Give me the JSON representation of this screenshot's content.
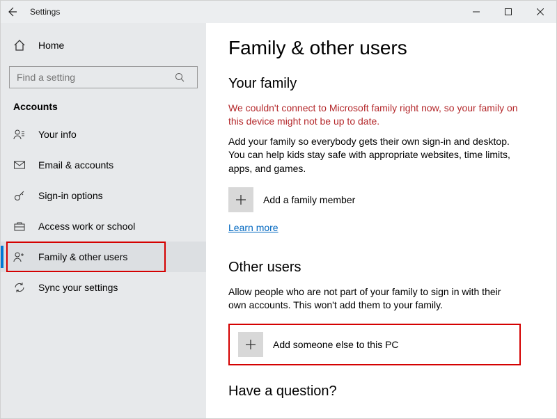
{
  "titlebar": {
    "title": "Settings"
  },
  "sidebar": {
    "home": "Home",
    "search_placeholder": "Find a setting",
    "section": "Accounts",
    "items": [
      {
        "label": "Your info"
      },
      {
        "label": "Email & accounts"
      },
      {
        "label": "Sign-in options"
      },
      {
        "label": "Access work or school"
      },
      {
        "label": "Family & other users"
      },
      {
        "label": "Sync your settings"
      }
    ]
  },
  "content": {
    "title": "Family & other users",
    "family_heading": "Your family",
    "family_error": "We couldn't connect to Microsoft family right now, so your family on this device might not be up to date.",
    "family_desc": "Add your family so everybody gets their own sign-in and desktop. You can help kids stay safe with appropriate websites, time limits, apps, and games.",
    "add_family": "Add a family member",
    "learn_more": "Learn more",
    "other_heading": "Other users",
    "other_desc": "Allow people who are not part of your family to sign in with their own accounts. This won't add them to your family.",
    "add_other": "Add someone else to this PC",
    "question_heading": "Have a question?"
  }
}
